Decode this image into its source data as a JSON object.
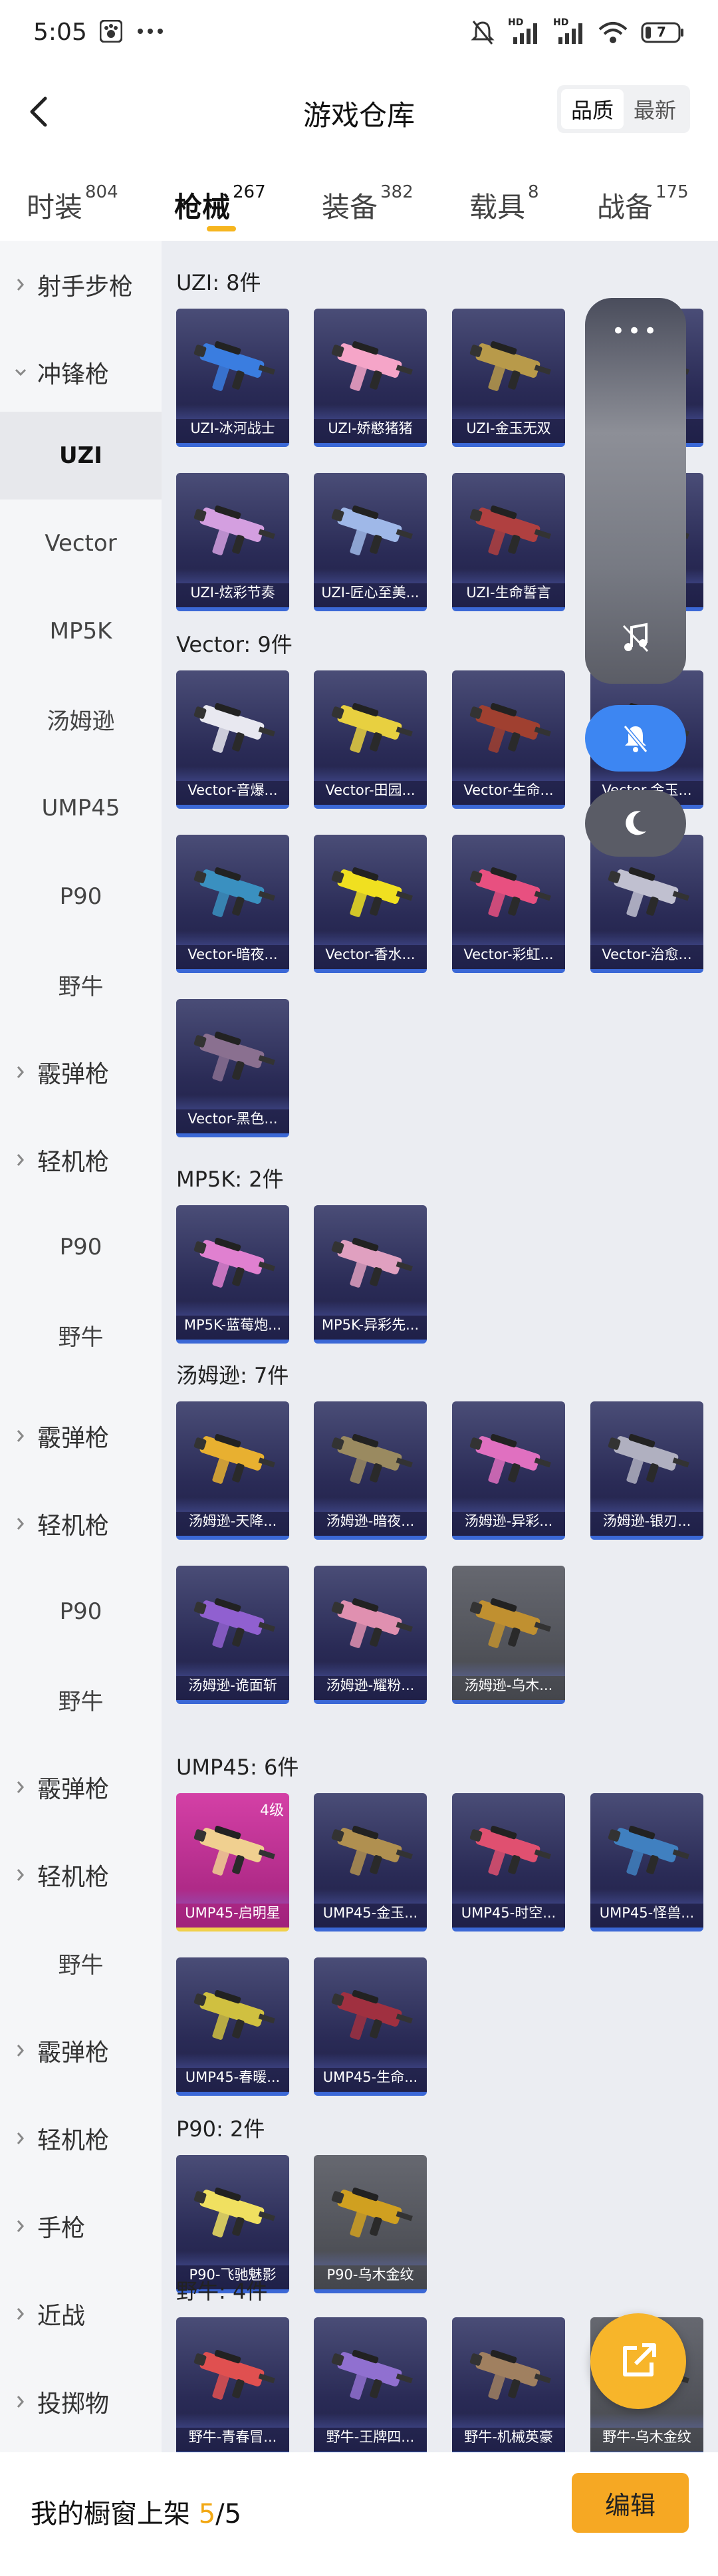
{
  "status_bar": {
    "time": "5:05",
    "network_labels": [
      "HD",
      "HD"
    ],
    "battery": "7",
    "icons": [
      "paw-icon",
      "more-dots-icon",
      "mute-bell-icon",
      "signal-icon",
      "signal-icon",
      "wifi-icon",
      "battery-icon"
    ]
  },
  "header": {
    "title": "游戏仓库",
    "sort_options": [
      "品质",
      "最新"
    ],
    "selected_sort": "品质"
  },
  "tabs": [
    {
      "label": "时装",
      "count": "804"
    },
    {
      "label": "枪械",
      "count": "267",
      "active": true
    },
    {
      "label": "装备",
      "count": "382"
    },
    {
      "label": "载具",
      "count": "8"
    },
    {
      "label": "战备",
      "count": "175"
    }
  ],
  "sidebar": [
    {
      "label": "射手步枪",
      "type": "category",
      "expanded": false
    },
    {
      "label": "冲锋枪",
      "type": "category",
      "expanded": true
    },
    {
      "label": "UZI",
      "type": "sub",
      "selected": true
    },
    {
      "label": "Vector",
      "type": "sub"
    },
    {
      "label": "MP5K",
      "type": "sub"
    },
    {
      "label": "汤姆逊",
      "type": "sub"
    },
    {
      "label": "UMP45",
      "type": "sub"
    },
    {
      "label": "P90",
      "type": "sub"
    },
    {
      "label": "野牛",
      "type": "sub"
    },
    {
      "label": "霰弹枪",
      "type": "category"
    },
    {
      "label": "轻机枪",
      "type": "category"
    },
    {
      "label": "P90",
      "type": "sub"
    },
    {
      "label": "野牛",
      "type": "sub"
    },
    {
      "label": "霰弹枪",
      "type": "category"
    },
    {
      "label": "轻机枪",
      "type": "category"
    },
    {
      "label": "P90",
      "type": "sub"
    },
    {
      "label": "野牛",
      "type": "sub"
    },
    {
      "label": "霰弹枪",
      "type": "category"
    },
    {
      "label": "轻机枪",
      "type": "category"
    },
    {
      "label": "野牛",
      "type": "sub"
    },
    {
      "label": "霰弹枪",
      "type": "category"
    },
    {
      "label": "轻机枪",
      "type": "category"
    },
    {
      "label": "手枪",
      "type": "category"
    },
    {
      "label": "近战",
      "type": "category"
    },
    {
      "label": "投掷物",
      "type": "category"
    }
  ],
  "sections": [
    {
      "title": "UZI: 8件",
      "items": [
        {
          "name": "UZI-冰河战士",
          "color": "#3a7de0"
        },
        {
          "name": "UZI-娇憨猪猪",
          "color": "#f5a5c8"
        },
        {
          "name": "UZI-金玉无双",
          "color": "#b89a4a"
        },
        {
          "name": "",
          "color": "#6a6a80"
        },
        {
          "name": "UZI-炫彩节奏",
          "color": "#d49fe0"
        },
        {
          "name": "UZI-匠心至美...",
          "color": "#9fb8e8"
        },
        {
          "name": "UZI-生命誓言",
          "color": "#b04040"
        },
        {
          "name": "",
          "color": "#6a6a80"
        }
      ]
    },
    {
      "title": "Vector: 9件",
      "items": [
        {
          "name": "Vector-音爆...",
          "color": "#e8e8f0"
        },
        {
          "name": "Vector-田园...",
          "color": "#e8d040"
        },
        {
          "name": "Vector-生命...",
          "color": "#a04030"
        },
        {
          "name": "Vector-金玉...",
          "color": "#c8b060"
        },
        {
          "name": "Vector-暗夜...",
          "color": "#3a90c0"
        },
        {
          "name": "Vector-香水...",
          "color": "#f0e020"
        },
        {
          "name": "Vector-彩虹...",
          "color": "#e85080"
        },
        {
          "name": "Vector-治愈...",
          "color": "#c0c0d0"
        },
        {
          "name": "Vector-黑色...",
          "color": "#8a7090"
        }
      ]
    },
    {
      "title": "MP5K: 2件",
      "items": [
        {
          "name": "MP5K-蓝莓炮...",
          "color": "#e080d0"
        },
        {
          "name": "MP5K-异彩先...",
          "color": "#e0a0c0"
        }
      ]
    },
    {
      "title": "汤姆逊: 7件",
      "items": [
        {
          "name": "汤姆逊-天降...",
          "color": "#e8b030"
        },
        {
          "name": "汤姆逊-暗夜...",
          "color": "#9a8a60"
        },
        {
          "name": "汤姆逊-异彩...",
          "color": "#e070c0"
        },
        {
          "name": "汤姆逊-银刃...",
          "color": "#b0b0c0"
        },
        {
          "name": "汤姆逊-诡面斩",
          "color": "#9060d0"
        },
        {
          "name": "汤姆逊-耀粉...",
          "color": "#e090b0"
        },
        {
          "name": "汤姆逊-乌木...",
          "color": "#c09030",
          "gray": true
        }
      ]
    },
    {
      "title": "UMP45: 6件",
      "items": [
        {
          "name": "UMP45-启明星",
          "color": "#f0d090",
          "pink": true,
          "level": "4级"
        },
        {
          "name": "UMP45-金玉...",
          "color": "#b09050"
        },
        {
          "name": "UMP45-时空...",
          "color": "#e05070"
        },
        {
          "name": "UMP45-怪兽...",
          "color": "#4080c0"
        },
        {
          "name": "UMP45-春暖...",
          "color": "#d0c040"
        },
        {
          "name": "UMP45-生命...",
          "color": "#a03040"
        }
      ]
    },
    {
      "title": "P90: 2件",
      "items": [
        {
          "name": "P90-飞驰魅影",
          "color": "#f0e060"
        },
        {
          "name": "P90-乌木金纹",
          "color": "#d0a020",
          "gray": true
        }
      ]
    },
    {
      "title": "野牛: 4件",
      "items": [
        {
          "name": "野牛-青春冒...",
          "color": "#e05050"
        },
        {
          "name": "野牛-王牌四...",
          "color": "#9070d0"
        },
        {
          "name": "野牛-机械英豪",
          "color": "#a08060"
        },
        {
          "name": "野牛-乌木金纹",
          "color": "#c09030",
          "gray": true
        }
      ]
    }
  ],
  "floating": {
    "dots": "•••"
  },
  "bottom_bar": {
    "label": "我的橱窗上架",
    "current": "5",
    "separator": "/",
    "total": "5",
    "edit_label": "编辑"
  }
}
